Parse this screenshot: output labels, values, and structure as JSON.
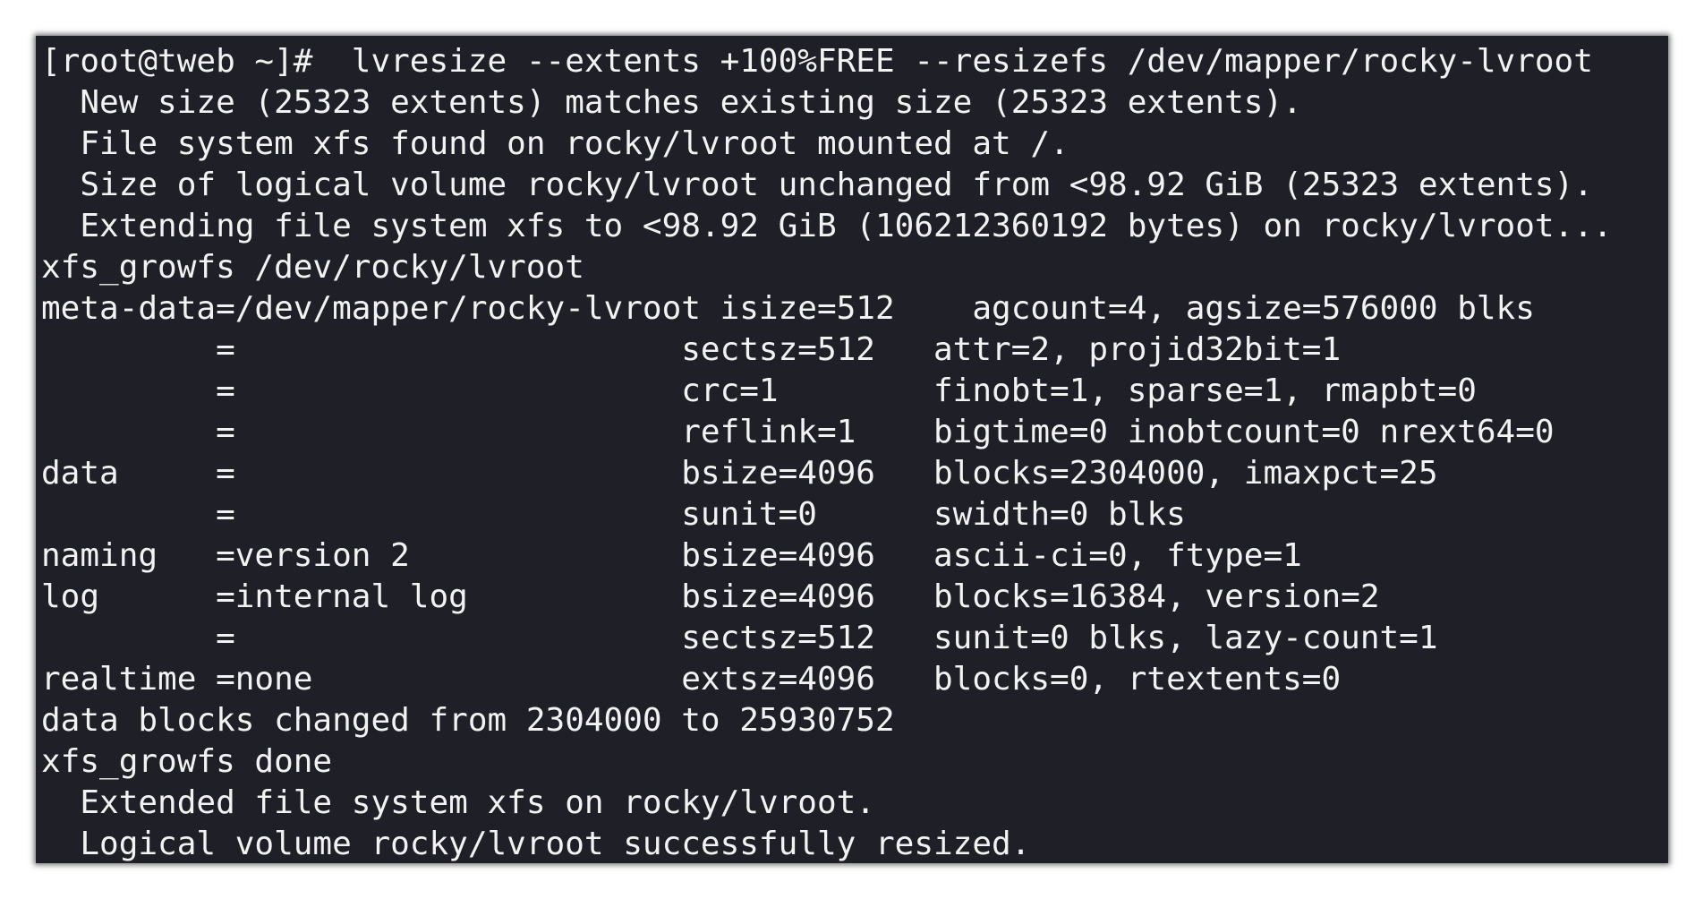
{
  "terminal": {
    "prompt": "[root@tweb ~]# ",
    "command": " lvresize --extents +100%FREE --resizefs /dev/mapper/rocky-lvroot",
    "output": [
      "  New size (25323 extents) matches existing size (25323 extents).",
      "  File system xfs found on rocky/lvroot mounted at /.",
      "  Size of logical volume rocky/lvroot unchanged from <98.92 GiB (25323 extents).",
      "  Extending file system xfs to <98.92 GiB (106212360192 bytes) on rocky/lvroot...",
      "xfs_growfs /dev/rocky/lvroot",
      "meta-data=/dev/mapper/rocky-lvroot isize=512    agcount=4, agsize=576000 blks",
      "         =                       sectsz=512   attr=2, projid32bit=1",
      "         =                       crc=1        finobt=1, sparse=1, rmapbt=0",
      "         =                       reflink=1    bigtime=0 inobtcount=0 nrext64=0",
      "data     =                       bsize=4096   blocks=2304000, imaxpct=25",
      "         =                       sunit=0      swidth=0 blks",
      "naming   =version 2              bsize=4096   ascii-ci=0, ftype=1",
      "log      =internal log           bsize=4096   blocks=16384, version=2",
      "         =                       sectsz=512   sunit=0 blks, lazy-count=1",
      "realtime =none                   extsz=4096   blocks=0, rtextents=0",
      "data blocks changed from 2304000 to 25930752",
      "xfs_growfs done",
      "  Extended file system xfs on rocky/lvroot.",
      "  Logical volume rocky/lvroot successfully resized."
    ]
  },
  "colors": {
    "background": "#1f1f27",
    "foreground": "#f2f2f2"
  }
}
